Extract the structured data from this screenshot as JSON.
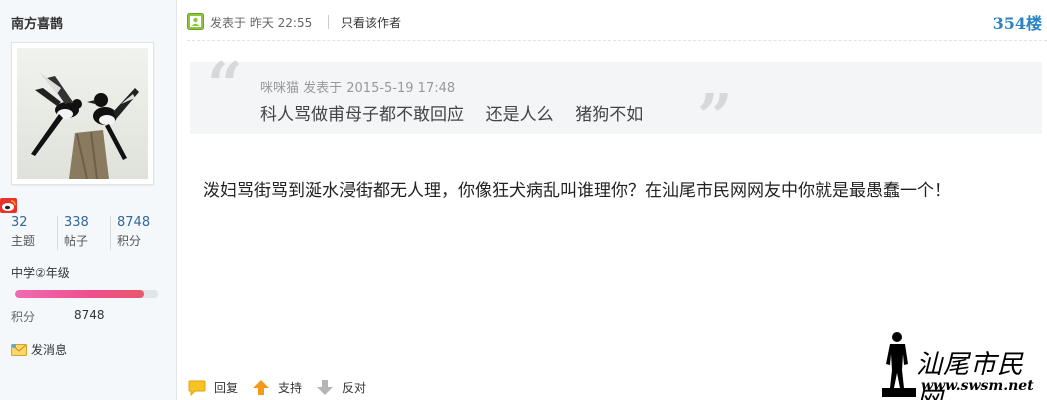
{
  "author": {
    "name": "南方喜鹊",
    "stats": [
      {
        "value": "32",
        "label": "主题"
      },
      {
        "value": "338",
        "label": "帖子"
      },
      {
        "value": "8748",
        "label": "积分"
      }
    ],
    "level": "中学②年级",
    "level_progress": 0.9,
    "score_label": "积分",
    "score_value": "8748",
    "send_message": "发消息"
  },
  "post": {
    "posted_at": "发表于 昨天 22:55",
    "only_author": "只看该作者",
    "floor": "354楼",
    "quote": {
      "meta": "咪咪猫 发表于 2015-5-19 17:48",
      "text": "科人骂做甫母子都不敢回应    还是人么    猪狗不如"
    },
    "body": "泼妇骂街骂到涎水浸街都无人理，你像狂犬病乱叫谁理你？在汕尾市民网网友中你就是最愚蠢一个！"
  },
  "actions": {
    "reply": "回复",
    "support": "支持",
    "oppose": "反对"
  },
  "watermark": {
    "title": "汕尾市民网",
    "url": "www.swsm.net"
  },
  "colors": {
    "floor": "#2a84c4",
    "progress": "#ee4f8c",
    "support_arrow": "#f39a1c"
  }
}
